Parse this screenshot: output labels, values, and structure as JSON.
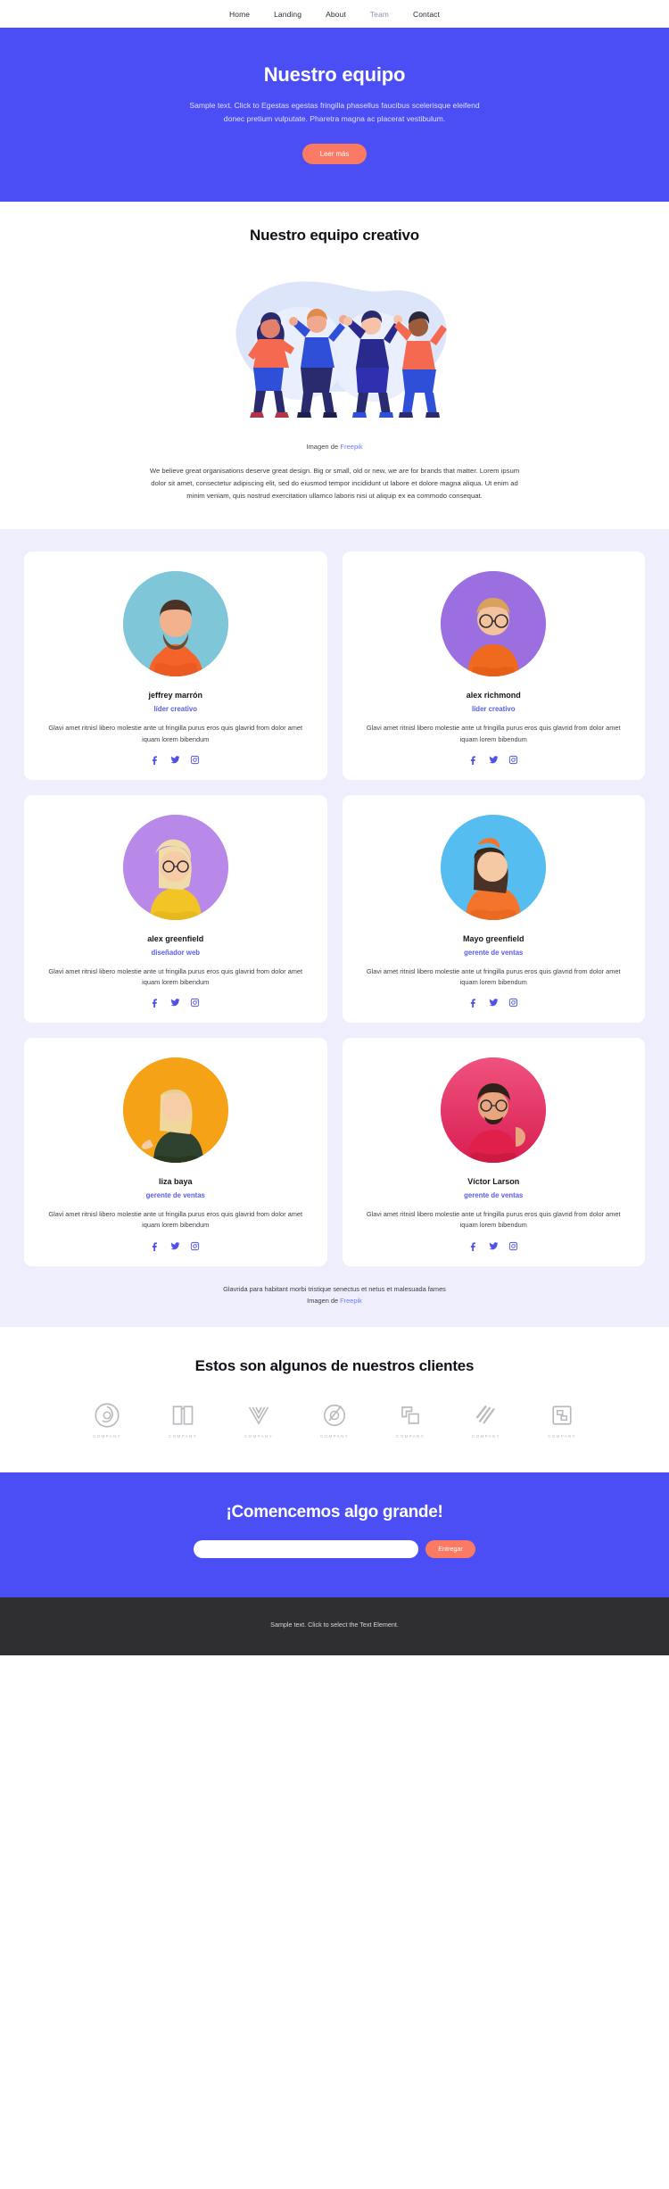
{
  "nav": {
    "items": [
      {
        "label": "Home",
        "active": false
      },
      {
        "label": "Landing",
        "active": false
      },
      {
        "label": "About",
        "active": false
      },
      {
        "label": "Team",
        "active": true
      },
      {
        "label": "Contact",
        "active": false
      }
    ]
  },
  "hero": {
    "title": "Nuestro equipo",
    "subtitle": "Sample text. Click to Egestas egestas fringilla phasellus faucibus scelerisque eleifend donec pretium vulputate. Pharetra magna ac placerat vestibulum.",
    "button": "Leer más",
    "background": "#4b4ef5",
    "button_color": "#fb7a64"
  },
  "creative": {
    "heading": "Nuestro equipo creativo",
    "credit_prefix": "Imagen de ",
    "credit_link": "Freepik",
    "body": "We believe great organisations deserve great design. Big or small, old or new, we are for brands that matter. Lorem ipsum dolor sit amet, consectetur adipiscing elit, sed do eiusmod tempor incididunt ut labore et dolore magna aliqua. Ut enim ad minim veniam, quis nostrud exercitation ullamco laboris nisi ut aliquip ex ea commodo consequat."
  },
  "team": {
    "bio": "Glavi amet ritnisl libero molestie ante ut fringilla purus eros quis glavrid from dolor amet iquam lorem bibendum",
    "social_icons": [
      "facebook-icon",
      "twitter-icon",
      "instagram-icon"
    ],
    "members": [
      {
        "name": "jeffrey marrón",
        "role": "líder creativo",
        "avatar_bg": "#7fc6d8",
        "shirt": "#f4642a"
      },
      {
        "name": "alex richmond",
        "role": "líder creativo",
        "avatar_bg": "#9b6fe0",
        "shirt": "#ef6a1e"
      },
      {
        "name": "alex greenfield",
        "role": "diseñador web",
        "avatar_bg": "#b989ea",
        "shirt": "#f2c425"
      },
      {
        "name": "Mayo greenfield",
        "role": "gerente de ventas",
        "avatar_bg": "#56bdf0",
        "shirt": "#f4742b"
      },
      {
        "name": "liza baya",
        "role": "gerente de ventas",
        "avatar_bg": "#f5a217",
        "shirt": "#2f4230"
      },
      {
        "name": "Víctor Larson",
        "role": "gerente de ventas",
        "avatar_bg": "#ea3462",
        "shirt": "#e01f4a"
      }
    ],
    "footer_line1": "Glavrida para habitant morbi tristique senectus et netus et malesuada fames",
    "footer_prefix": "Imagen de ",
    "footer_link": "Freepik",
    "role_color": "#5a5ee8",
    "background": "#eeeefc"
  },
  "clients": {
    "heading": "Estos son algunos de nuestros clientes",
    "logos": [
      {
        "caption": "COMPANY",
        "icon": "circle-swirl-logo"
      },
      {
        "caption": "COMPANY",
        "icon": "book-open-logo"
      },
      {
        "caption": "COMPANY",
        "icon": "wave-lines-logo"
      },
      {
        "caption": "COMPANY",
        "icon": "circle-slash-logo"
      },
      {
        "caption": "COMPANY",
        "icon": "corner-squares-logo"
      },
      {
        "caption": "COMPANY",
        "icon": "diagonal-stripes-logo"
      },
      {
        "caption": "COMPANY",
        "icon": "bracket-block-logo"
      }
    ]
  },
  "cta": {
    "heading": "¡Comencemos algo grande!",
    "input_value": "",
    "input_placeholder": "",
    "button": "Entregar"
  },
  "footer": {
    "text": "Sample text. Click to select the Text Element.",
    "background": "#2f2f32"
  }
}
